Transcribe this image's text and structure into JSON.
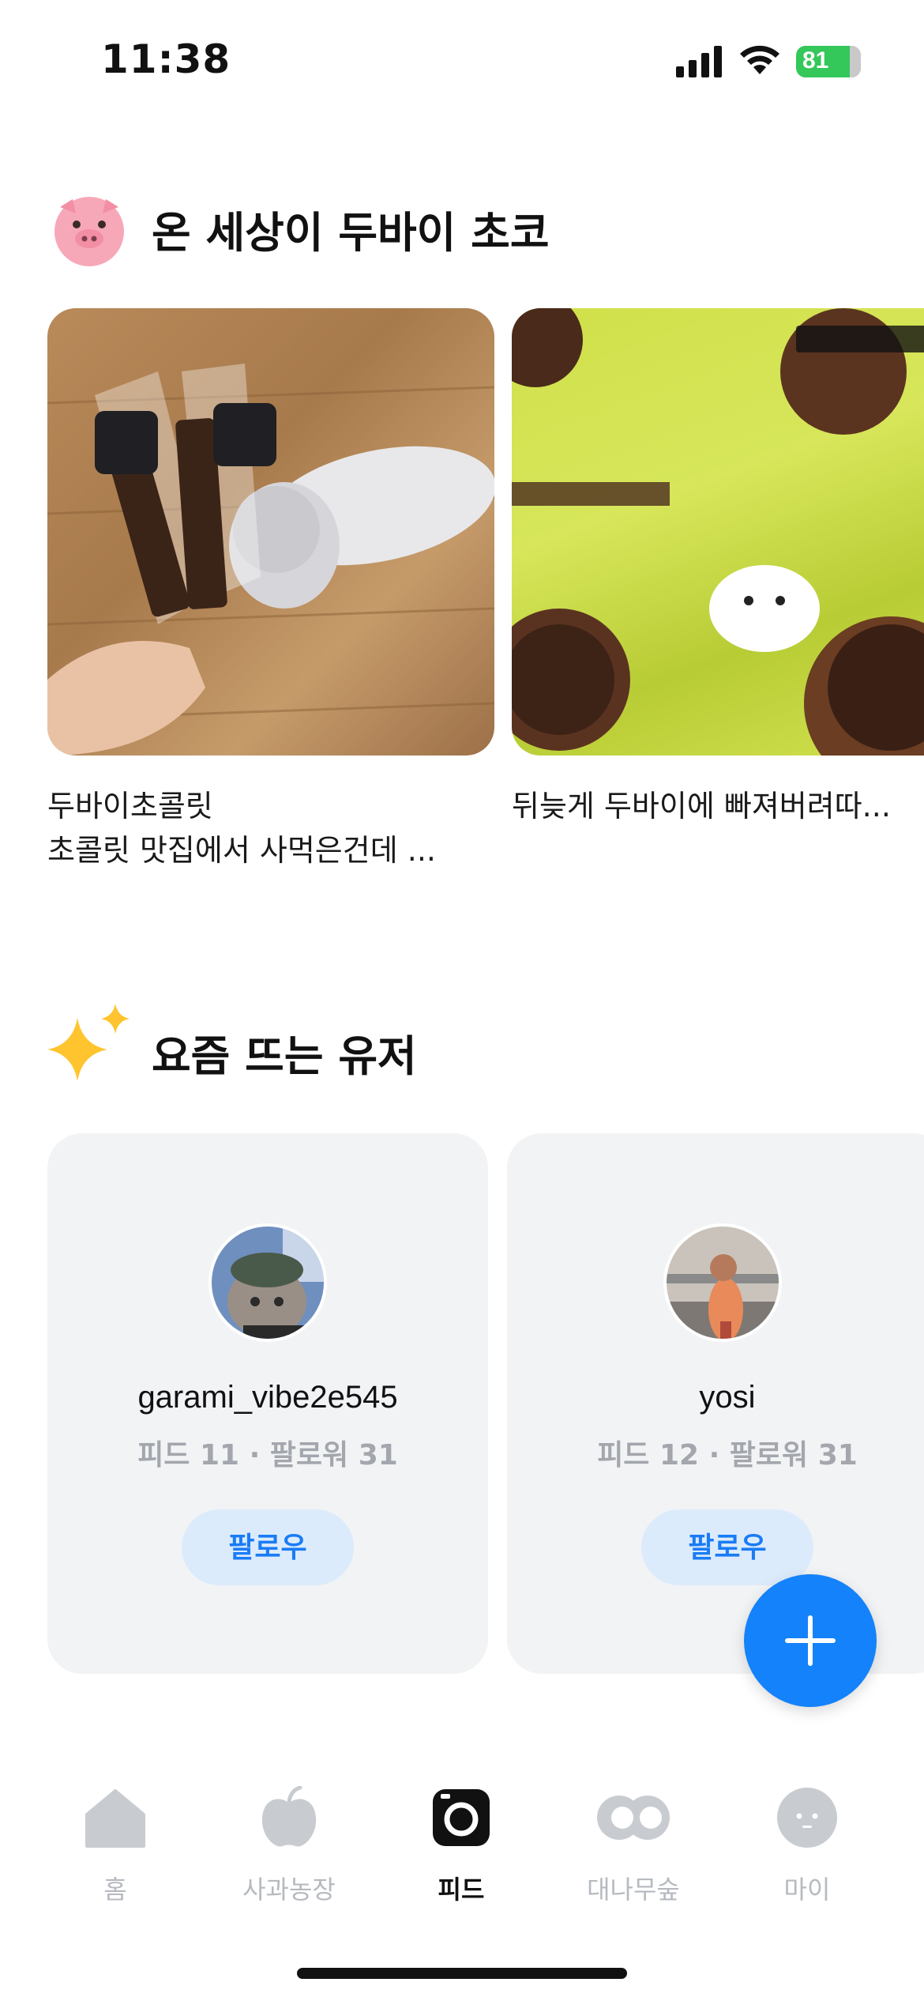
{
  "status_bar": {
    "time": "11:38",
    "battery_level": "81",
    "icons": [
      "signal-icon",
      "wifi-icon",
      "battery-icon"
    ]
  },
  "sections": {
    "dubai": {
      "title": "온 세상이 두바이 초코",
      "icon": "pig-icon",
      "posts": [
        {
          "title": "두바이초콜릿",
          "subtitle": "초콜릿 맛집에서 사먹은건데 ..."
        },
        {
          "title": "뒤늦게 두바이에 빠져버려따..."
        }
      ]
    },
    "trending_users": {
      "title": "요즘 뜨는 유저",
      "icon": "sparkle-icon",
      "users": [
        {
          "username": "garami_vibe2e545",
          "stats": "피드 11 · 팔로워 31",
          "follow_label": "팔로우"
        },
        {
          "username": "yosi",
          "stats": "피드 12 · 팔로워 31",
          "follow_label": "팔로우"
        }
      ]
    }
  },
  "fab": {
    "icon": "plus-icon"
  },
  "bottom_nav": {
    "active": "피드",
    "items": [
      {
        "label": "홈",
        "icon": "home-icon"
      },
      {
        "label": "사과농장",
        "icon": "apple-icon"
      },
      {
        "label": "피드",
        "icon": "camera-icon"
      },
      {
        "label": "대나무숲",
        "icon": "bamboo-icon"
      },
      {
        "label": "마이",
        "icon": "profile-icon"
      }
    ]
  },
  "colors": {
    "accent": "#1482fa",
    "follow_bg": "#dcebfc",
    "card_bg": "#f2f3f5",
    "muted": "#a3a7ad",
    "battery": "#34c759"
  }
}
